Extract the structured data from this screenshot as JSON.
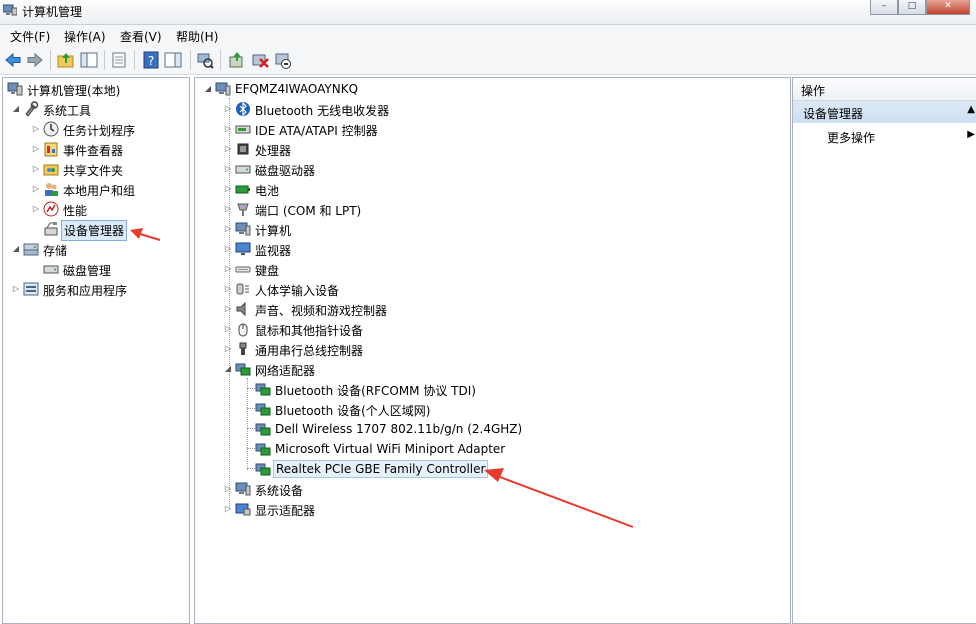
{
  "window": {
    "title": "计算机管理"
  },
  "window_buttons": {
    "minimize": "–",
    "maximize": "□",
    "close": "✕"
  },
  "menu": [
    "文件(F)",
    "操作(A)",
    "查看(V)",
    "帮助(H)"
  ],
  "left_tree": {
    "root": "计算机管理(本地)",
    "items": [
      {
        "label": "系统工具",
        "icon": "tools-icon"
      },
      {
        "label": "任务计划程序",
        "icon": "clock-icon"
      },
      {
        "label": "事件查看器",
        "icon": "event-viewer-icon"
      },
      {
        "label": "共享文件夹",
        "icon": "shared-folder-icon"
      },
      {
        "label": "本地用户和组",
        "icon": "users-icon"
      },
      {
        "label": "性能",
        "icon": "performance-icon"
      },
      {
        "label": "设备管理器",
        "icon": "device-manager-icon"
      },
      {
        "label": "存储",
        "icon": "storage-icon"
      },
      {
        "label": "磁盘管理",
        "icon": "disk-icon"
      },
      {
        "label": "服务和应用程序",
        "icon": "services-icon"
      }
    ]
  },
  "device_tree": {
    "computer": "EFQMZ4IWAOAYNKQ",
    "categories": [
      "Bluetooth 无线电收发器",
      "IDE ATA/ATAPI 控制器",
      "处理器",
      "磁盘驱动器",
      "电池",
      "端口 (COM 和 LPT)",
      "计算机",
      "监视器",
      "键盘",
      "人体学输入设备",
      "声音、视频和游戏控制器",
      "鼠标和其他指针设备",
      "通用串行总线控制器",
      "网络适配器"
    ],
    "network_adapters": [
      "Bluetooth 设备(RFCOMM 协议 TDI)",
      "Bluetooth 设备(个人区域网)",
      "Dell Wireless 1707 802.11b/g/n (2.4GHZ)",
      "Microsoft Virtual WiFi Miniport Adapter",
      "Realtek PCIe GBE Family Controller"
    ],
    "after": [
      "系统设备",
      "显示适配器"
    ]
  },
  "actions": {
    "header": "操作",
    "section": "设备管理器",
    "more": "更多操作"
  },
  "colors": {
    "annotation_arrow": "#e8392b",
    "selection": "#dcebfc"
  }
}
